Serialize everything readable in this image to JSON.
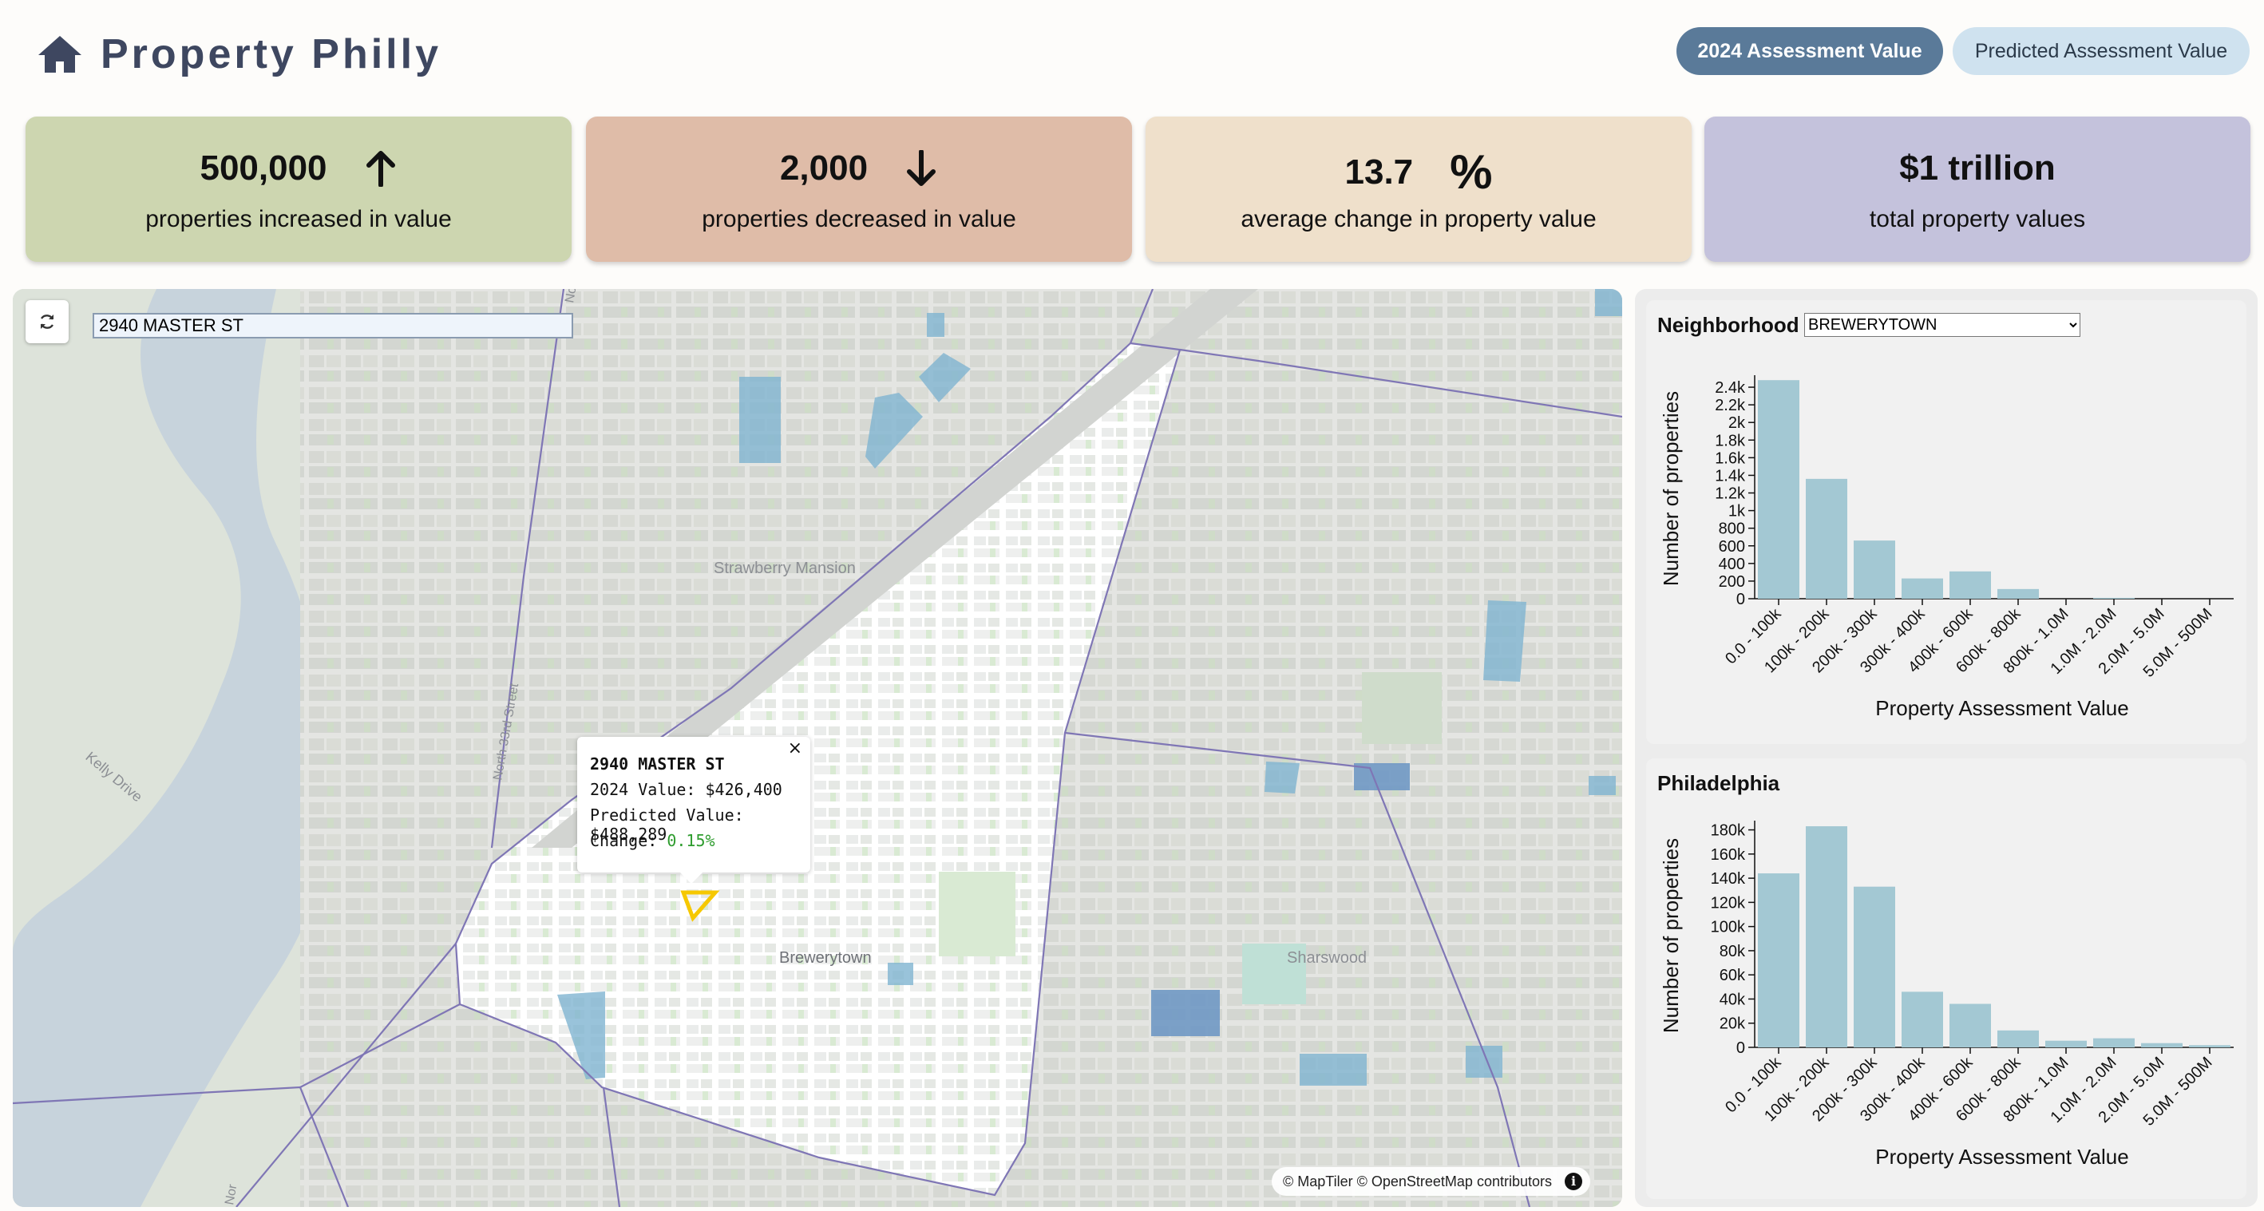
{
  "header": {
    "title": "Property Philly",
    "toggle_active": "2024 Assessment Value",
    "toggle_inactive": "Predicted Assessment Value"
  },
  "stats": [
    {
      "value": "500,000",
      "label": "properties increased in value",
      "icon": "arrow-up-icon",
      "color": "#cdd6b0"
    },
    {
      "value": "2,000",
      "label": "properties decreased in value",
      "icon": "arrow-down-icon",
      "color": "#dfbca8"
    },
    {
      "value": "13.7",
      "label": "average change in property value",
      "icon": "percent-icon",
      "symbol": "%",
      "color": "#efe0cb"
    },
    {
      "value": "$1 trillion",
      "label": "total property values",
      "icon": "",
      "color": "#c4c2dc"
    }
  ],
  "map": {
    "search_value": "2940 MASTER ST",
    "labels": {
      "strawberry": "Strawberry Mansion",
      "brewerytown": "Brewerytown",
      "sharswood": "Sharswood",
      "kelly": "Kelly Drive",
      "street_33": "North 33rd Street",
      "no_top": "No",
      "no_bottom": "Nor"
    },
    "popup": {
      "address": "2940 MASTER ST",
      "value_label": "2024 Value:",
      "value": "$426,400",
      "predicted_label": "Predicted Value:",
      "predicted": "$488,289",
      "change_label": "Change:",
      "change": "0.15%",
      "close": "×"
    },
    "attribution": "© MapTiler © OpenStreetMap contributors",
    "info": "i"
  },
  "neighborhood_panel": {
    "label": "Neighborhood",
    "selected": "BREWERYTOWN"
  },
  "philly_panel": {
    "label": "Philadelphia"
  },
  "chart_data": [
    {
      "type": "bar",
      "title": "",
      "xlabel": "Property Assessment Value",
      "ylabel": "Number of properties",
      "categories": [
        "0.0 - 100k",
        "100k - 200k",
        "200k - 300k",
        "300k - 400k",
        "400k - 600k",
        "600k - 800k",
        "800k - 1.0M",
        "1.0M - 2.0M",
        "2.0M - 5.0M",
        "5.0M - 500M"
      ],
      "values": [
        2480,
        1360,
        660,
        230,
        310,
        110,
        0,
        10,
        0,
        0
      ],
      "yticks": [
        0,
        200,
        400,
        600,
        800,
        1000,
        1200,
        1400,
        1600,
        1800,
        2000,
        2200,
        2400
      ],
      "ytick_labels": [
        "0",
        "200",
        "400",
        "600",
        "800",
        "1k",
        "1.2k",
        "1.4k",
        "1.6k",
        "1.8k",
        "2k",
        "2.2k",
        "2.4k"
      ],
      "ylim": [
        0,
        2500
      ],
      "bar_color": "#a3c8d3"
    },
    {
      "type": "bar",
      "title": "",
      "xlabel": "Property Assessment Value",
      "ylabel": "Number of properties",
      "categories": [
        "0.0 - 100k",
        "100k - 200k",
        "200k - 300k",
        "300k - 400k",
        "400k - 600k",
        "600k - 800k",
        "800k - 1.0M",
        "1.0M - 2.0M",
        "2.0M - 5.0M",
        "5.0M - 500M"
      ],
      "values": [
        144000,
        183000,
        133000,
        46000,
        36000,
        14000,
        5500,
        7500,
        3500,
        1800
      ],
      "yticks": [
        0,
        20000,
        40000,
        60000,
        80000,
        100000,
        120000,
        140000,
        160000,
        180000
      ],
      "ytick_labels": [
        "0",
        "20k",
        "40k",
        "60k",
        "80k",
        "100k",
        "120k",
        "140k",
        "160k",
        "180k"
      ],
      "ylim": [
        0,
        185000
      ],
      "bar_color": "#a3c8d3"
    }
  ]
}
